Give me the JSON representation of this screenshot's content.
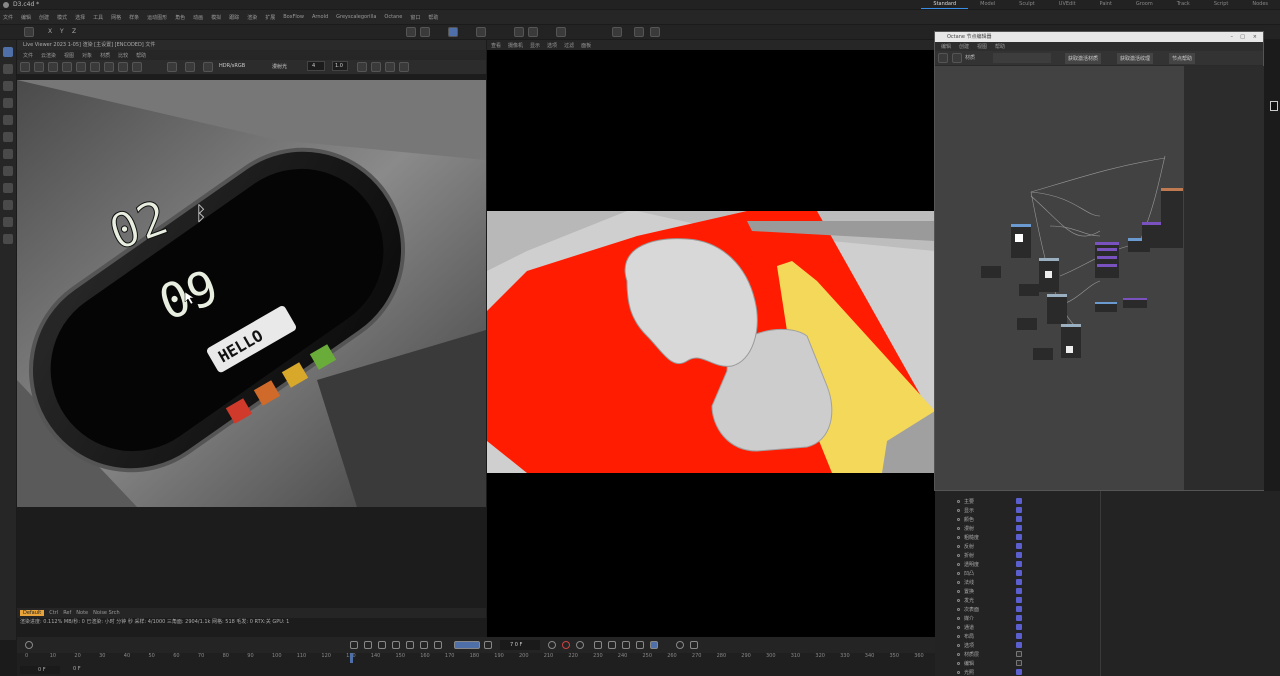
{
  "window": {
    "tab_title": "D3.c4d *",
    "layouts": [
      "Standard",
      "Model",
      "Sculpt",
      "UVEdit",
      "Paint",
      "Groom",
      "Track",
      "Script",
      "Nodes"
    ]
  },
  "menubar": {
    "items": [
      "文件",
      "编辑",
      "创建",
      "模式",
      "选择",
      "工具",
      "网格",
      "样条",
      "运动图形",
      "角色",
      "动画",
      "模拟",
      "跟踪",
      "渲染",
      "扩展",
      "BoxFlow",
      "Arnold",
      "Greyscalegorilla",
      "Octane",
      "窗口",
      "帮助"
    ]
  },
  "coords_bar": {
    "x": "X",
    "y": "Y",
    "z": "Z"
  },
  "render_panel": {
    "title": "Live Viewer 2023 1-05] 渲染 [主设置] [ENCODED] 文件",
    "menu": [
      "文件",
      "云渲染",
      "视图",
      "对象",
      "材质",
      "比较",
      "帮助"
    ],
    "color_mode": "HDR/sRGB",
    "mode": "漫射光",
    "samples": "4",
    "pass_value": "1.0",
    "tab_labels": [
      "Default",
      "Ctrl",
      "Ref",
      "Note",
      "Noise Srch"
    ],
    "status": "渲染进度: 0.112%  MB/秒: 0  已渲染: 小时  分钟  秒  采样: 4/1000  三角面: 2904/1.1k  网格: 518  毛发: 0  RTX:关  GPU: 1"
  },
  "hud": {
    "number_top": "02",
    "number_bottom": "09",
    "bubble_text": "HELLO"
  },
  "vp2": {
    "menu": [
      "查看",
      "摄像机",
      "显示",
      "选项",
      "过滤",
      "面板"
    ]
  },
  "node_editor": {
    "title": "Octane 节点编辑器",
    "menu": [
      "编辑",
      "创建",
      "视图",
      "帮助"
    ],
    "buttons": [
      "获取激活材质",
      "获取激活纹理",
      "节点帮助"
    ],
    "material_label": "材质"
  },
  "right_panel": {
    "rows": [
      {
        "label": "主要",
        "checked": true
      },
      {
        "label": "显示",
        "checked": true
      },
      {
        "label": "颜色",
        "checked": true
      },
      {
        "label": "漫射",
        "checked": true
      },
      {
        "label": "粗糙度",
        "checked": true
      },
      {
        "label": "反射",
        "checked": true
      },
      {
        "label": "折射",
        "checked": true
      },
      {
        "label": "透明度",
        "checked": true
      },
      {
        "label": "凹凸",
        "checked": true
      },
      {
        "label": "法线",
        "checked": true
      },
      {
        "label": "置换",
        "checked": true
      },
      {
        "label": "发光",
        "checked": true
      },
      {
        "label": "次表面",
        "checked": true
      },
      {
        "label": "媒介",
        "checked": true
      },
      {
        "label": "通道",
        "checked": true
      },
      {
        "label": "布局",
        "checked": true
      },
      {
        "label": "选项",
        "checked": true
      },
      {
        "label": "材质层",
        "checked": false
      },
      {
        "label": "编辑",
        "checked": false
      },
      {
        "label": "光照",
        "checked": true
      }
    ]
  },
  "timeline": {
    "current_frame": "7 0 F",
    "start": "0 F",
    "end_label": "0 F",
    "ticks": [
      "0",
      "10",
      "20",
      "30",
      "40",
      "50",
      "60",
      "70",
      "80",
      "90",
      "100",
      "110",
      "120",
      "130",
      "140",
      "150",
      "160",
      "170",
      "180",
      "190",
      "200",
      "210",
      "220",
      "230",
      "240",
      "250",
      "260",
      "270",
      "280",
      "290",
      "300",
      "310",
      "320",
      "330",
      "340",
      "350",
      "360"
    ]
  }
}
